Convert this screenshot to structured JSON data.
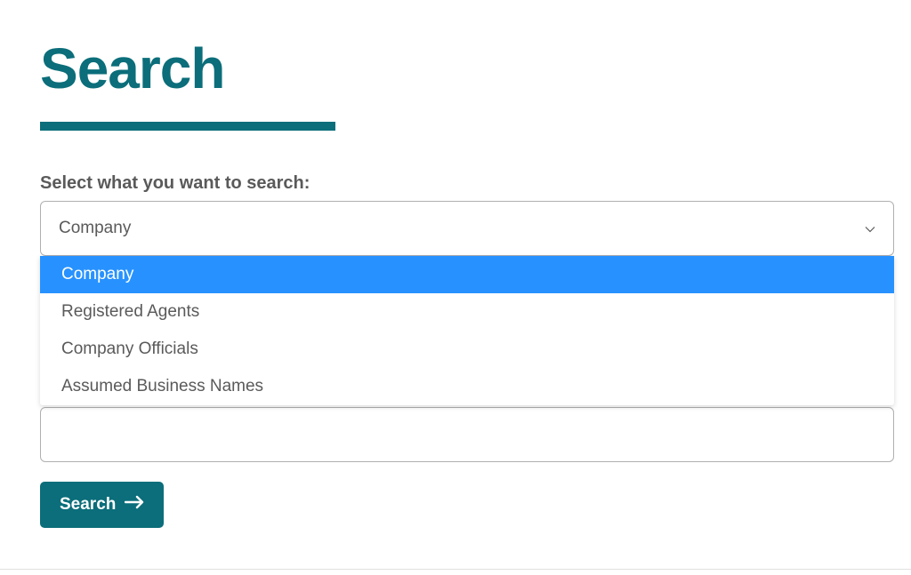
{
  "header": {
    "title": "Search"
  },
  "form": {
    "select_label": "Select what you want to search:",
    "select_value": "Company",
    "dropdown_options": [
      {
        "label": "Company",
        "highlighted": true
      },
      {
        "label": "Registered Agents",
        "highlighted": false
      },
      {
        "label": "Company Officials",
        "highlighted": false
      },
      {
        "label": "Assumed Business Names",
        "highlighted": false
      }
    ],
    "search_input_value": "",
    "search_button_label": "Search"
  },
  "colors": {
    "brand": "#0b6e7a",
    "highlight": "#2792ff",
    "text_muted": "#5a5a5a",
    "border": "#b0b0b0"
  }
}
